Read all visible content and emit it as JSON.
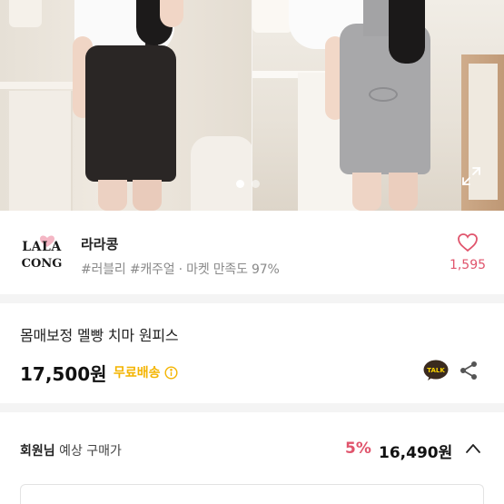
{
  "gallery": {
    "dots_total": 2,
    "active_dot": 1
  },
  "shop": {
    "logo_text": "LALA CONG",
    "name": "라라콩",
    "meta": "#러블리 #캐주얼 · 마켓 만족도 97%",
    "like_count": "1,595"
  },
  "product": {
    "title": "몸매보정 멜빵 치마 원피스",
    "price": "17,500원",
    "shipping": "무료배송",
    "talk_label": "TALK"
  },
  "member": {
    "label_bold": "회원님",
    "label_rest": " 예상 구매가",
    "discount": "5%",
    "price": "16,490원"
  },
  "colors": {
    "accent_pink": "#e0546c",
    "shipping_yellow": "#f4b400",
    "talk_yellow": "#f7d100"
  }
}
